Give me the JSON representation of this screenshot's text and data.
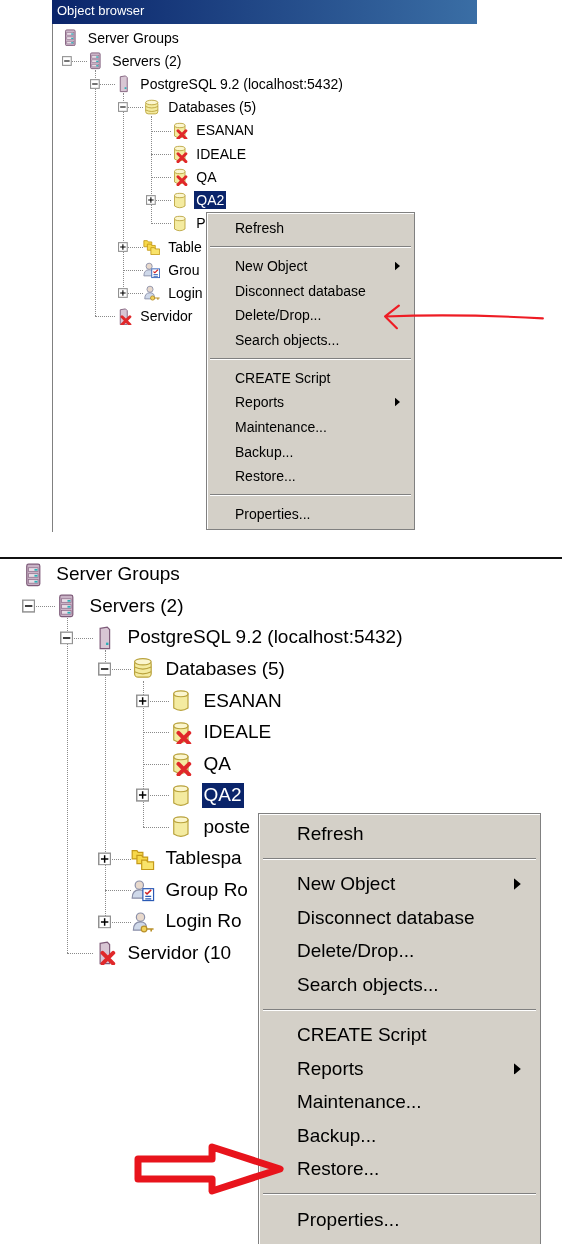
{
  "panels": [
    {
      "kind": "window",
      "title": "Object browser",
      "tree": [
        {
          "label": "Server Groups",
          "kind": "servergroup",
          "error": false,
          "expandable": false,
          "selected": false
        },
        {
          "label": "Servers (2)",
          "kind": "servergroup",
          "error": false,
          "expandable": true,
          "expanded": true,
          "selected": false,
          "children": [
            {
              "label": "PostgreSQL 9.2 (localhost:5432)",
              "kind": "server",
              "error": false,
              "expandable": true,
              "expanded": true,
              "selected": false,
              "children": [
                {
                  "label": "Databases (5)",
                  "kind": "databases",
                  "error": false,
                  "expandable": true,
                  "expanded": true,
                  "selected": false,
                  "children": [
                    {
                      "label": "ESANAN",
                      "kind": "database",
                      "error": true,
                      "expandable": false,
                      "selected": false
                    },
                    {
                      "label": "IDEALE",
                      "kind": "database",
                      "error": true,
                      "expandable": false,
                      "selected": false
                    },
                    {
                      "label": "QA",
                      "kind": "database",
                      "error": true,
                      "expandable": false,
                      "selected": false
                    },
                    {
                      "label": "QA2",
                      "kind": "database",
                      "error": false,
                      "expandable": true,
                      "expanded": false,
                      "selected": true
                    },
                    {
                      "label": "P",
                      "kind": "database",
                      "error": false,
                      "expandable": false,
                      "selected": false
                    }
                  ]
                },
                {
                  "label": "Table",
                  "kind": "tablespaces",
                  "error": false,
                  "expandable": true,
                  "expanded": false,
                  "selected": false
                },
                {
                  "label": "Grou",
                  "kind": "grouproles",
                  "error": false,
                  "expandable": false,
                  "selected": false
                },
                {
                  "label": "Login",
                  "kind": "loginroles",
                  "error": false,
                  "expandable": true,
                  "expanded": false,
                  "selected": false
                }
              ]
            },
            {
              "label": "Servidor",
              "kind": "server",
              "error": true,
              "expandable": false,
              "selected": false
            }
          ]
        }
      ],
      "menu": {
        "items": [
          {
            "kind": "item",
            "label": "Refresh",
            "submenu": false,
            "pointed": false
          },
          {
            "kind": "separator"
          },
          {
            "kind": "item",
            "label": "New Object",
            "submenu": true,
            "pointed": false
          },
          {
            "kind": "item",
            "label": "Disconnect database",
            "submenu": false,
            "pointed": false
          },
          {
            "kind": "item",
            "label": "Delete/Drop...",
            "submenu": false,
            "pointed": true
          },
          {
            "kind": "item",
            "label": "Search objects...",
            "submenu": false,
            "pointed": false
          },
          {
            "kind": "separator"
          },
          {
            "kind": "item",
            "label": "CREATE Script",
            "submenu": false,
            "pointed": false
          },
          {
            "kind": "item",
            "label": "Reports",
            "submenu": true,
            "pointed": false
          },
          {
            "kind": "item",
            "label": "Maintenance...",
            "submenu": false,
            "pointed": false
          },
          {
            "kind": "item",
            "label": "Backup...",
            "submenu": false,
            "pointed": false
          },
          {
            "kind": "item",
            "label": "Restore...",
            "submenu": false,
            "pointed": false
          },
          {
            "kind": "separator"
          },
          {
            "kind": "item",
            "label": "Properties...",
            "submenu": false,
            "pointed": false
          }
        ]
      }
    },
    {
      "kind": "zoomed",
      "tree": [
        {
          "label": "Server Groups",
          "kind": "servergroup",
          "error": false,
          "expandable": false,
          "selected": false
        },
        {
          "label": "Servers (2)",
          "kind": "servergroup",
          "error": false,
          "expandable": true,
          "expanded": true,
          "selected": false,
          "children": [
            {
              "label": "PostgreSQL 9.2 (localhost:5432)",
              "kind": "server",
              "error": false,
              "expandable": true,
              "expanded": true,
              "selected": false,
              "children": [
                {
                  "label": "Databases (5)",
                  "kind": "databases",
                  "error": false,
                  "expandable": true,
                  "expanded": true,
                  "selected": false,
                  "children": [
                    {
                      "label": "ESANAN",
                      "kind": "database",
                      "error": false,
                      "expandable": true,
                      "expanded": false,
                      "selected": false
                    },
                    {
                      "label": "IDEALE",
                      "kind": "database",
                      "error": true,
                      "expandable": false,
                      "selected": false
                    },
                    {
                      "label": "QA",
                      "kind": "database",
                      "error": true,
                      "expandable": false,
                      "selected": false
                    },
                    {
                      "label": "QA2",
                      "kind": "database",
                      "error": false,
                      "expandable": true,
                      "expanded": false,
                      "selected": true
                    },
                    {
                      "label": "poste",
                      "kind": "database",
                      "error": false,
                      "expandable": false,
                      "selected": false
                    }
                  ]
                },
                {
                  "label": "Tablespa",
                  "kind": "tablespaces",
                  "error": false,
                  "expandable": true,
                  "expanded": false,
                  "selected": false
                },
                {
                  "label": "Group Ro",
                  "kind": "grouproles",
                  "error": false,
                  "expandable": false,
                  "selected": false
                },
                {
                  "label": "Login Ro",
                  "kind": "loginroles",
                  "error": false,
                  "expandable": true,
                  "expanded": false,
                  "selected": false
                }
              ]
            },
            {
              "label": "Servidor (10",
              "kind": "server",
              "error": true,
              "expandable": false,
              "selected": false
            }
          ]
        }
      ],
      "menu": {
        "items": [
          {
            "kind": "item",
            "label": "Refresh",
            "submenu": false,
            "pointed": false
          },
          {
            "kind": "separator"
          },
          {
            "kind": "item",
            "label": "New Object",
            "submenu": true,
            "pointed": false
          },
          {
            "kind": "item",
            "label": "Disconnect database",
            "submenu": false,
            "pointed": false
          },
          {
            "kind": "item",
            "label": "Delete/Drop...",
            "submenu": false,
            "pointed": false
          },
          {
            "kind": "item",
            "label": "Search objects...",
            "submenu": false,
            "pointed": false
          },
          {
            "kind": "separator"
          },
          {
            "kind": "item",
            "label": "CREATE Script",
            "submenu": false,
            "pointed": false
          },
          {
            "kind": "item",
            "label": "Reports",
            "submenu": true,
            "pointed": false
          },
          {
            "kind": "item",
            "label": "Maintenance...",
            "submenu": false,
            "pointed": false
          },
          {
            "kind": "item",
            "label": "Backup...",
            "submenu": false,
            "pointed": false
          },
          {
            "kind": "item",
            "label": "Restore...",
            "submenu": false,
            "pointed": true
          },
          {
            "kind": "separator"
          },
          {
            "kind": "item",
            "label": "Properties...",
            "submenu": false,
            "pointed": false
          }
        ]
      }
    }
  ]
}
